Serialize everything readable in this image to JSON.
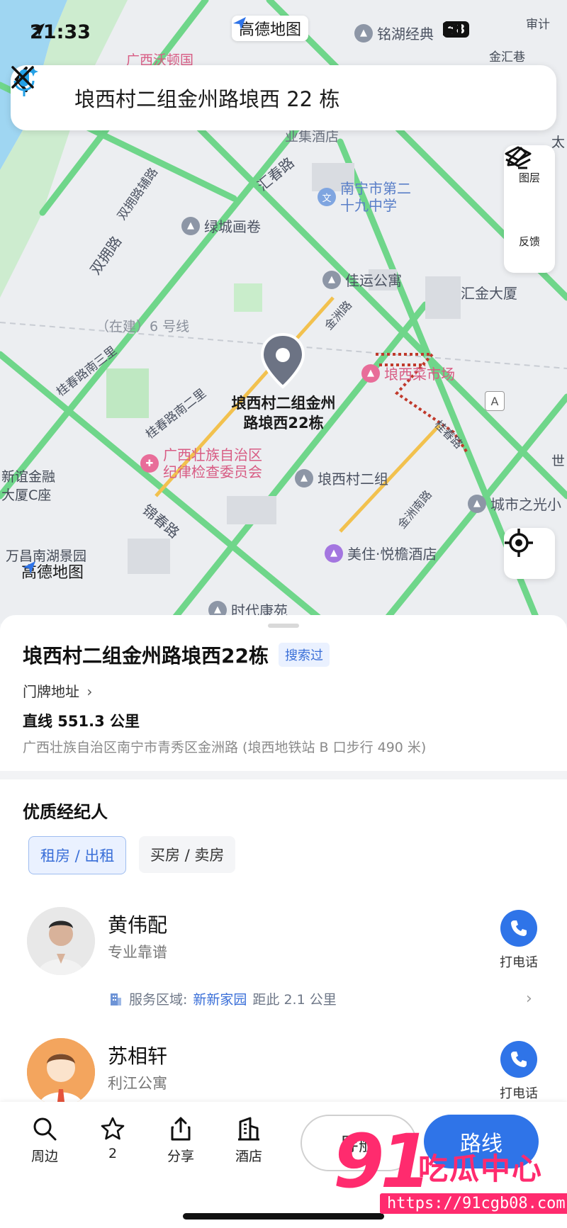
{
  "status_bar": {
    "time": "21:33",
    "battery": "68"
  },
  "brand": {
    "name": "高德地图"
  },
  "search": {
    "query": "埌西村二组金州路埌西 22 栋"
  },
  "map_tools": {
    "layers_label": "图层",
    "feedback_label": "反馈"
  },
  "map": {
    "pin_label_line1": "埌西村二组金州",
    "pin_label_line2": "路埌西22栋",
    "labels": {
      "guangxi_wodun": "广西沃顿国",
      "mingfu_jingdian": "铭湖经典",
      "jinhui_xiang": "金汇巷",
      "shenji": "审计",
      "zhangye": "业集酒店",
      "nanning_29_line1": "南宁市第二",
      "nanning_29_line2": "十九中学",
      "lvcheng": "绿城画卷",
      "jiayun": "佳运公寓",
      "huijin": "汇金大厦",
      "langxi_market": "埌西菜市场",
      "jiwei_line1": "广西壮族自治区",
      "jiwei_line2": "纪律检查委员会",
      "langxi_village": "埌西村二组",
      "cheng_light": "城市之光小",
      "meizhu": "美住·悦檐酒店",
      "xindao_line1": "新谊金融",
      "xindao_line2": "大厦C座",
      "wanchang": "万昌南湖景园",
      "shidai": "时代康苑",
      "metro_line": "（在建）6 号线",
      "tai": "太",
      "shi": "世"
    },
    "roads": {
      "shuangyong": "双拥路",
      "shuangyong_fu": "双拥路辅路",
      "huichun": "汇春路",
      "guichun_south3": "桂春路南三里",
      "guichun_south2": "桂春路南二里",
      "jinchun": "锦春路",
      "jinzhou": "金洲路",
      "jinzhou_south": "金洲南路",
      "guichun": "桂春路"
    }
  },
  "place": {
    "title": "埌西村二组金州路埌西22栋",
    "tag": "搜索过",
    "doorplate": "门牌地址",
    "distance": "直线 551.3 公里",
    "address": "广西壮族自治区南宁市青秀区金洲路 (埌西地铁站 B 口步行 490 米)"
  },
  "agents_section": {
    "title": "优质经纪人",
    "filters": [
      "租房 / 出租",
      "买房 / 卖房"
    ],
    "call_label": "打电话",
    "agents": [
      {
        "name": "黄伟配",
        "desc": "专业靠谱",
        "service_label": "服务区域:",
        "service_area": "新新家园",
        "service_distance": "距此 2.1 公里"
      },
      {
        "name": "苏相轩",
        "desc": "利江公寓"
      }
    ]
  },
  "bottom_nav": {
    "items": [
      {
        "label": "周边",
        "icon": "search-icon"
      },
      {
        "label": "2",
        "icon": "star-icon"
      },
      {
        "label": "分享",
        "icon": "share-icon"
      },
      {
        "label": "酒店",
        "icon": "hotel-icon"
      }
    ],
    "navigate_label": "导航",
    "route_label": "路线"
  },
  "watermark": {
    "number": "91",
    "text": "吃瓜中心",
    "url": "https://91cgb08.com"
  },
  "colors": {
    "accent": "#2f74e8",
    "road_green": "#6fd68a",
    "road_yellow": "#f2c14e",
    "watermark": "#ff2b6e"
  }
}
